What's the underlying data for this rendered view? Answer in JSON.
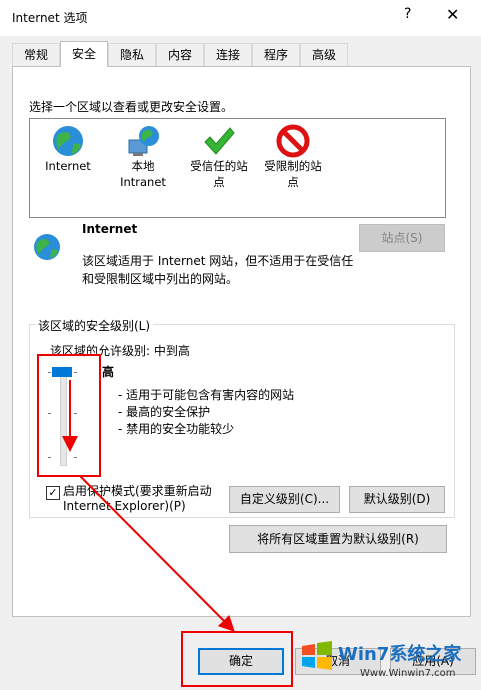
{
  "window": {
    "title": "Internet 选项",
    "help": "?",
    "close": "✕"
  },
  "tabs": [
    "常规",
    "安全",
    "隐私",
    "内容",
    "连接",
    "程序",
    "高级"
  ],
  "intro": "选择一个区域以查看或更改安全设置。",
  "zones": [
    {
      "label": "Internet",
      "icon": "globe-icon"
    },
    {
      "label": "本地\nIntranet",
      "icon": "intranet-icon"
    },
    {
      "label": "受信任的站\n点",
      "icon": "check-icon"
    },
    {
      "label": "受限制的站\n点",
      "icon": "restricted-icon"
    }
  ],
  "selected_zone": {
    "name": "Internet",
    "desc_line1": "该区域适用于 Internet 网站，但不适用于在受信任",
    "desc_line2": "和受限制区域中列出的网站。",
    "sites_button": "站点(S)"
  },
  "security_level": {
    "group_title": "该区域的安全级别(L)",
    "allowed": "该区域的允许级别: 中到高",
    "level": "高",
    "bullets": [
      "- 适用于可能包含有害内容的网站",
      "- 最高的安全保护",
      "- 禁用的安全功能较少"
    ],
    "protected_mode_line1": "启用保护模式(要求重新启动",
    "protected_mode_line2": "Internet Explorer)(P)",
    "protected_mode_checked": "✓",
    "custom_button": "自定义级别(C)...",
    "default_button": "默认级别(D)",
    "reset_all_button": "将所有区域重置为默认级别(R)"
  },
  "footer": {
    "ok": "确定",
    "cancel": "取消",
    "apply": "应用(A)"
  },
  "watermark": {
    "brand": "Win7系统之家",
    "url": "Www.Winwin7.com"
  },
  "colors": {
    "accent": "#0078d7",
    "annotation_red": "#e00000"
  }
}
